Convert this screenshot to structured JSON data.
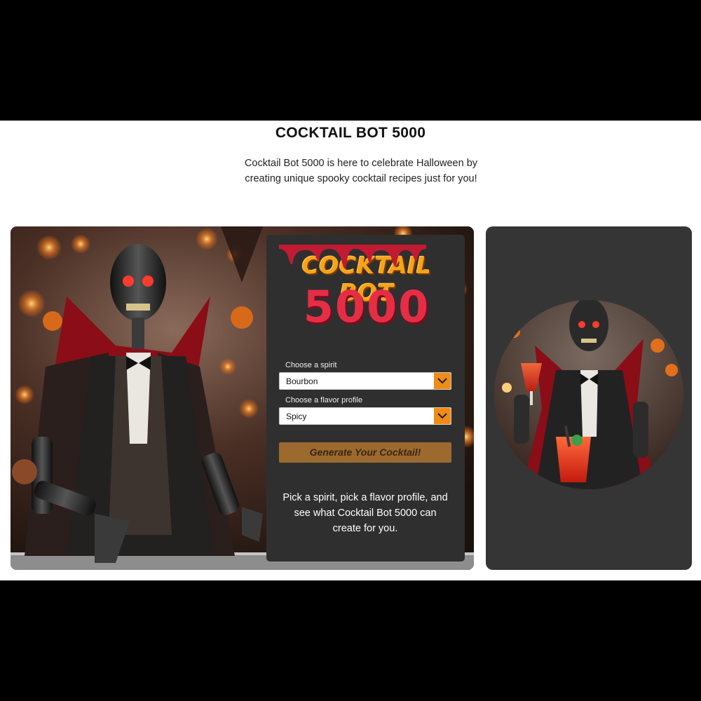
{
  "header": {
    "title": "COCKTAIL BOT 5000",
    "intro": "Cocktail Bot 5000 is here to celebrate Halloween by creating unique spooky cocktail recipes just for you!"
  },
  "logo": {
    "line1": "COCKTAIL BOT",
    "line2": "5000"
  },
  "form": {
    "spirit_label": "Choose a spirit",
    "spirit_value": "Bourbon",
    "flavor_label": "Choose a flavor profile",
    "flavor_value": "Spicy",
    "generate_label": "Generate Your Cocktail!"
  },
  "result": {
    "help_text": "Pick a spirit, pick a flavor profile, and see what Cocktail Bot 5000 can create for you."
  },
  "colors": {
    "accent_orange": "#f08c16",
    "button_brown": "#9c6a2e",
    "panel_dark": "#2f2f2f",
    "logo_red": "#e52e46",
    "logo_orange": "#f7a21b"
  },
  "icons": {
    "select_arrow": "chevron-down-icon"
  }
}
